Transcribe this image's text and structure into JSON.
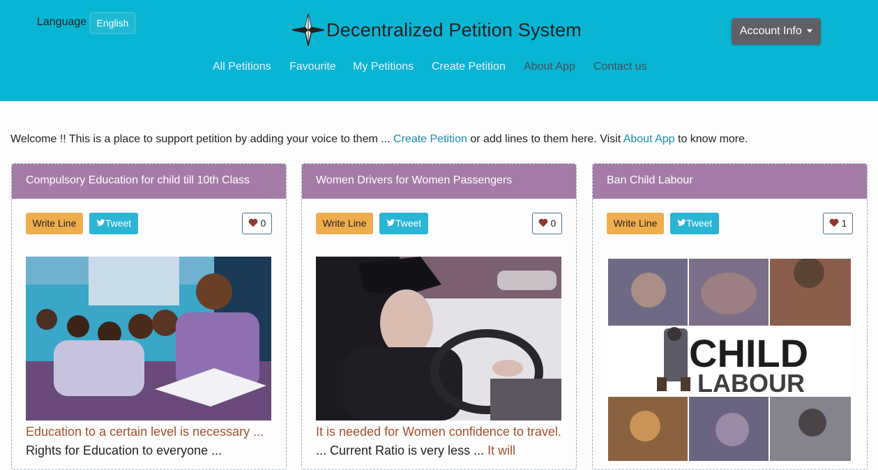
{
  "header": {
    "language_label": "Language",
    "language_value": "English",
    "title": "Decentralized Petition System",
    "account_label": "Account Info",
    "colors": {
      "background": "#08b5d3",
      "account_button": "#5f6066"
    }
  },
  "nav": {
    "items": [
      {
        "label": "All Petitions"
      },
      {
        "label": "Favourite"
      },
      {
        "label": "My Petitions"
      },
      {
        "label": "Create Petition"
      },
      {
        "label": "About App"
      },
      {
        "label": "Contact us"
      }
    ]
  },
  "welcome": {
    "text_1": "Welcome !! This is a place to support petition by adding your voice to them ... ",
    "link_create": "Create Petition",
    "text_2": " or add lines to them here. Visit ",
    "link_about": "About App",
    "text_3": " to know more."
  },
  "cards": [
    {
      "title": "Compulsory Education for child till 10th Class",
      "write_label": "Write Line",
      "tweet_label": "Tweet",
      "likes": "0",
      "text_brown_1": "Education to a certain level is necessary ...",
      "text_dark_1": "Rights for Education to everyone ...",
      "text_brown_2": ""
    },
    {
      "title": "Women Drivers for Women Passengers",
      "write_label": "Write Line",
      "tweet_label": "Tweet",
      "likes": "0",
      "text_brown_1": "It is needed for Women confidence to travel.",
      "text_dark_1": " ... Current Ratio is very less ... ",
      "text_brown_2": "It will"
    },
    {
      "title": "Ban Child Labour",
      "write_label": "Write Line",
      "tweet_label": "Tweet",
      "likes": "1",
      "poster_line_1": "CHILD",
      "poster_line_2": "LABOUR"
    }
  ],
  "colors": {
    "card_header": "#a57ba8",
    "write_button": "#f0ad4e",
    "tweet_button": "#2bb4d3",
    "link": "#1a8bb2",
    "brown_text": "#a0522d"
  }
}
